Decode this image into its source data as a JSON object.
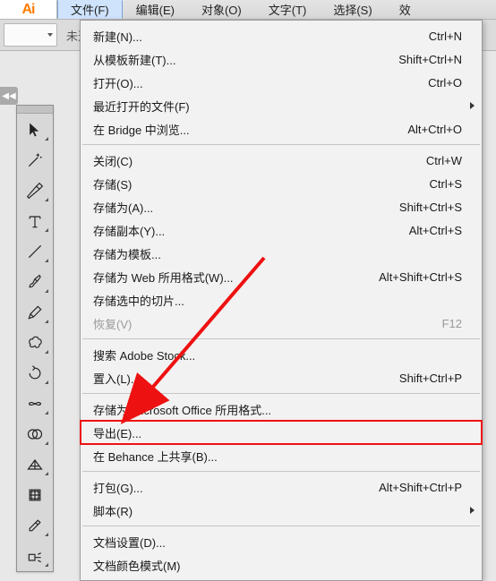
{
  "app_icon": "Ai",
  "menubar": {
    "items": [
      {
        "label": "文件(F)",
        "active": true
      },
      {
        "label": "编辑(E)"
      },
      {
        "label": "对象(O)"
      },
      {
        "label": "文字(T)"
      },
      {
        "label": "选择(S)"
      },
      {
        "label": "效"
      }
    ]
  },
  "substrip": {
    "noselect": "未选"
  },
  "collapse_glyph": "◀◀",
  "file_menu": {
    "items": [
      {
        "label": "新建(N)...",
        "shortcut": "Ctrl+N"
      },
      {
        "label": "从模板新建(T)...",
        "shortcut": "Shift+Ctrl+N"
      },
      {
        "label": "打开(O)...",
        "shortcut": "Ctrl+O"
      },
      {
        "label": "最近打开的文件(F)",
        "submenu": true
      },
      {
        "label": "在 Bridge 中浏览...",
        "shortcut": "Alt+Ctrl+O"
      },
      {
        "sep": true
      },
      {
        "label": "关闭(C)",
        "shortcut": "Ctrl+W"
      },
      {
        "label": "存储(S)",
        "shortcut": "Ctrl+S"
      },
      {
        "label": "存储为(A)...",
        "shortcut": "Shift+Ctrl+S"
      },
      {
        "label": "存储副本(Y)...",
        "shortcut": "Alt+Ctrl+S"
      },
      {
        "label": "存储为模板..."
      },
      {
        "label": "存储为 Web 所用格式(W)...",
        "shortcut": "Alt+Shift+Ctrl+S"
      },
      {
        "label": "存储选中的切片..."
      },
      {
        "label": "恢复(V)",
        "shortcut": "F12",
        "disabled": true
      },
      {
        "sep": true
      },
      {
        "label": "搜索 Adobe Stock..."
      },
      {
        "label": "置入(L)...",
        "shortcut": "Shift+Ctrl+P"
      },
      {
        "sep": true
      },
      {
        "label": "存储为 Microsoft Office 所用格式..."
      },
      {
        "label": "导出(E)...",
        "highlight": true
      },
      {
        "label": "在 Behance 上共享(B)..."
      },
      {
        "sep": true
      },
      {
        "label": "打包(G)...",
        "shortcut": "Alt+Shift+Ctrl+P"
      },
      {
        "label": "脚本(R)",
        "submenu": true
      },
      {
        "sep": true
      },
      {
        "label": "文档设置(D)..."
      },
      {
        "label": "文档颜色模式(M)"
      }
    ]
  }
}
